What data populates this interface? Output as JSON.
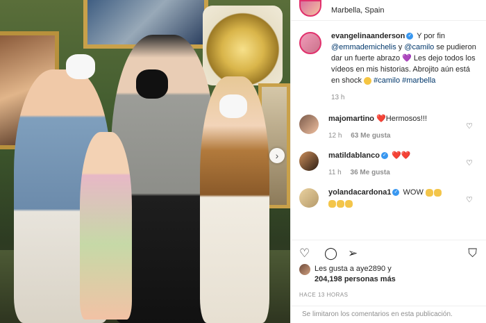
{
  "header": {
    "location": "Marbella, Spain"
  },
  "caption": {
    "username": "evangelinaanderson",
    "text_1": "Y por fin",
    "mention_1": "@emmademichelis",
    "text_2": "y",
    "mention_2": "@camilo",
    "text_3": "se pudieron dar un fuerte abrazo",
    "emoji_1": "💜",
    "text_4": "Les dejo todos los vídeos en mis historias. Abrojito aún está en shock",
    "hashtag_1": "#camilo",
    "hashtag_2": "#marbella",
    "time": "13 h"
  },
  "comments": [
    {
      "username": "majomartino",
      "text": "Hermosos!!!",
      "emoji": "❤️",
      "time": "12 h",
      "likes": "63 Me gusta"
    },
    {
      "username": "matildablanco",
      "text": "",
      "emoji": "❤️❤️",
      "time": "11 h",
      "likes": "36 Me gusta"
    },
    {
      "username": "yolandacardona1",
      "text": "WOW",
      "emoji": "👏👏",
      "time": "",
      "likes": ""
    }
  ],
  "likes": {
    "line1": "Les gusta a aye2890 y",
    "line2": "204,198 personas más"
  },
  "posted": "HACE 13 HORAS",
  "comments_limited": "Se limitaron los comentarios en esta publicación.",
  "icons": {
    "next": "chevron-right-icon",
    "like": "heart-icon",
    "comment": "comment-icon",
    "share": "send-icon",
    "save": "bookmark-icon"
  },
  "colors": {
    "link": "#00376b",
    "meta": "#8e8e8e",
    "verified": "#3897f0",
    "story_ring": "#e1306c"
  }
}
